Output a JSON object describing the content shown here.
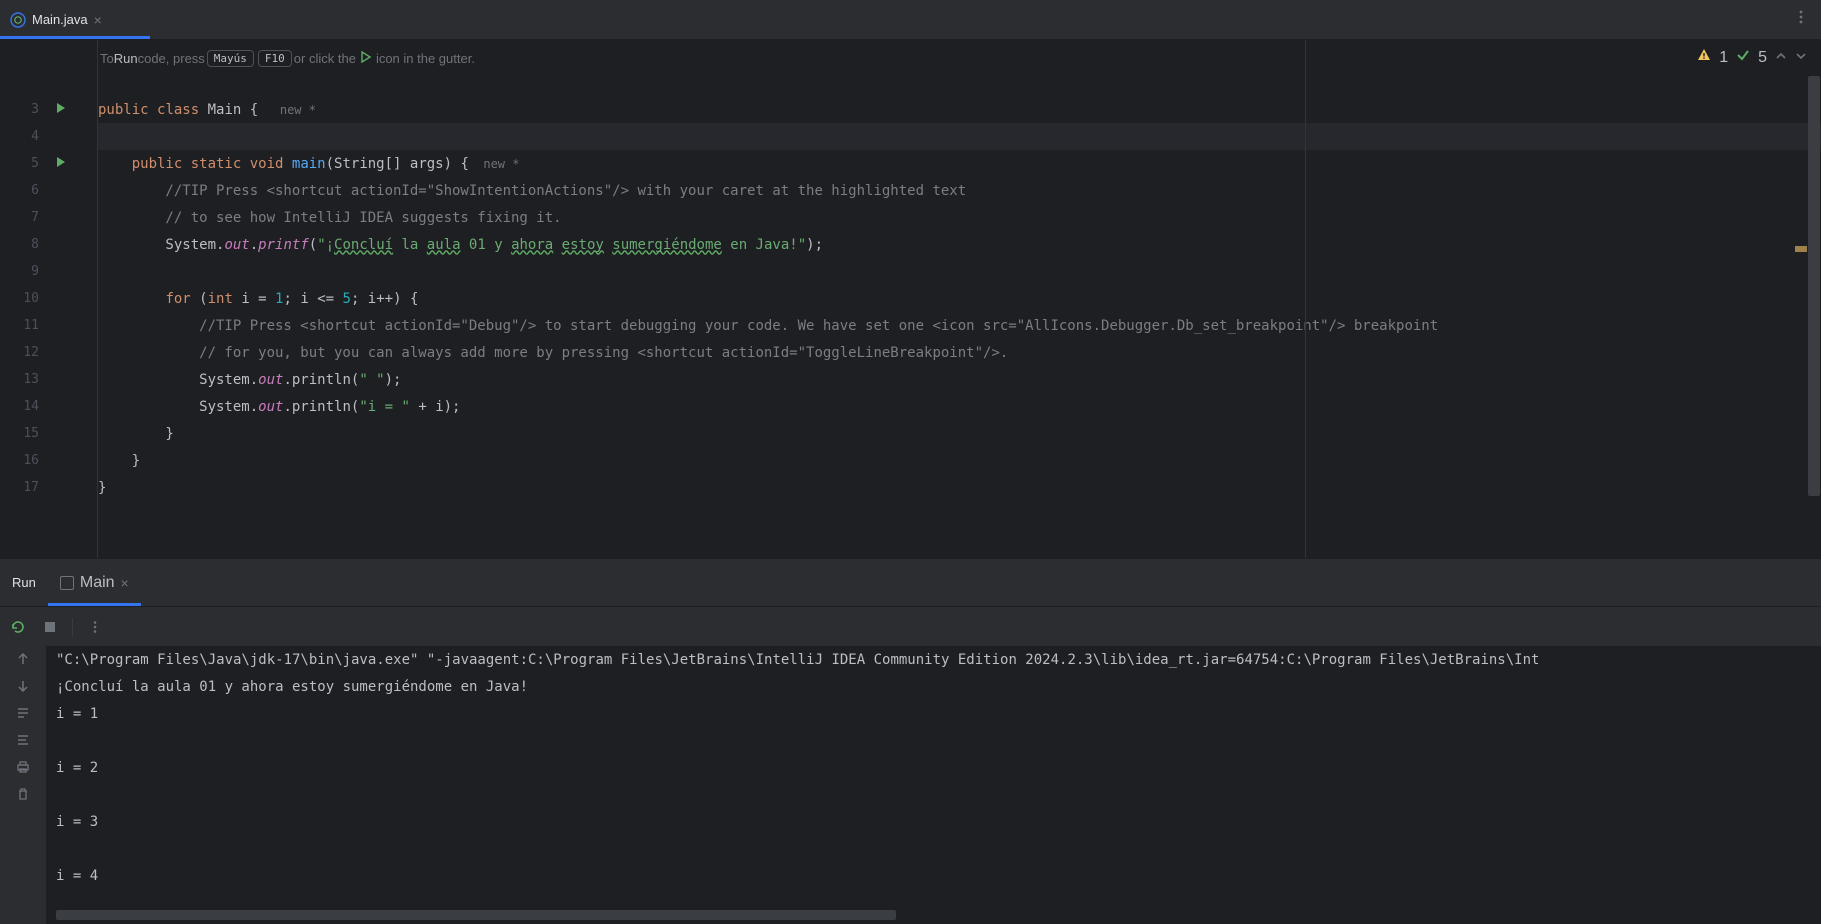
{
  "tab": {
    "filename": "Main.java"
  },
  "hint": {
    "prefix": "To ",
    "run": "Run",
    "text1": " code, press ",
    "key1": "Mayús",
    "key2": "F10",
    "text2": " or click the ",
    "text3": " icon in the gutter."
  },
  "inspections": {
    "warnings": "1",
    "typos": "5"
  },
  "gutter": {
    "lines": [
      "3",
      "4",
      "5",
      "6",
      "7",
      "8",
      "9",
      "10",
      "11",
      "12",
      "13",
      "14",
      "15",
      "16",
      "17"
    ]
  },
  "code": {
    "l3": {
      "kw1": "public ",
      "kw2": "class ",
      "name": "Main ",
      "brace": "{",
      "hint": "   new *"
    },
    "l5": {
      "kw1": "    public ",
      "kw2": "static ",
      "kw3": "void ",
      "method": "main",
      "params": "(String[] args) {",
      "hint": "  new *"
    },
    "l6": "        //TIP Press <shortcut actionId=\"ShowIntentionActions\"/> with your caret at the highlighted text",
    "l7": "        // to see how IntelliJ IDEA suggests fixing it.",
    "l8": {
      "pre": "        System.",
      "out": "out",
      "dot": ".",
      "printf": "printf",
      "paren": "(",
      "str1": "\"¡",
      "t1": "Concluí",
      "sp1": " la ",
      "t2": "aula",
      "sp2": " 01 y ",
      "t3": "ahora",
      "sp3": " ",
      "t4": "estoy",
      "sp4": " ",
      "t5": "sumergiéndome",
      "sp5": " en Java!\"",
      "end": ");"
    },
    "l10": {
      "sp": "        ",
      "for": "for ",
      "p": "(",
      "int": "int ",
      "i1": "i",
      "eq": " = ",
      "one": "1",
      "semi": "; ",
      "i2": "i",
      "le": " <= ",
      "five": "5",
      "semi2": "; ",
      "i3": "i",
      "inc": "++) {"
    },
    "l11": "            //TIP Press <shortcut actionId=\"Debug\"/> to start debugging your code. We have set one <icon src=\"AllIcons.Debugger.Db_set_breakpoint\"/> breakpoint",
    "l12": "            // for you, but you can always add more by pressing <shortcut actionId=\"ToggleLineBreakpoint\"/>.",
    "l13": {
      "pre": "            System.",
      "out": "out",
      "rest": ".println(",
      "str": "\" \"",
      "end": ");"
    },
    "l14": {
      "pre": "            System.",
      "out": "out",
      "rest": ".println(",
      "str": "\"i = \"",
      "plus": " + ",
      "i": "i",
      "end": ");"
    },
    "l15": "        }",
    "l16": "    }",
    "l17": "}"
  },
  "run_panel": {
    "title": "Run",
    "config": "Main"
  },
  "console": {
    "l1": "\"C:\\Program Files\\Java\\jdk-17\\bin\\java.exe\" \"-javaagent:C:\\Program Files\\JetBrains\\IntelliJ IDEA Community Edition 2024.2.3\\lib\\idea_rt.jar=64754:C:\\Program Files\\JetBrains\\Int",
    "l2": "¡Concluí la aula 01 y ahora estoy sumergiéndome en Java!",
    "l3": "i = 1",
    "l4": "",
    "l5": "i = 2",
    "l6": "",
    "l7": "i = 3",
    "l8": "",
    "l9": "i = 4"
  }
}
